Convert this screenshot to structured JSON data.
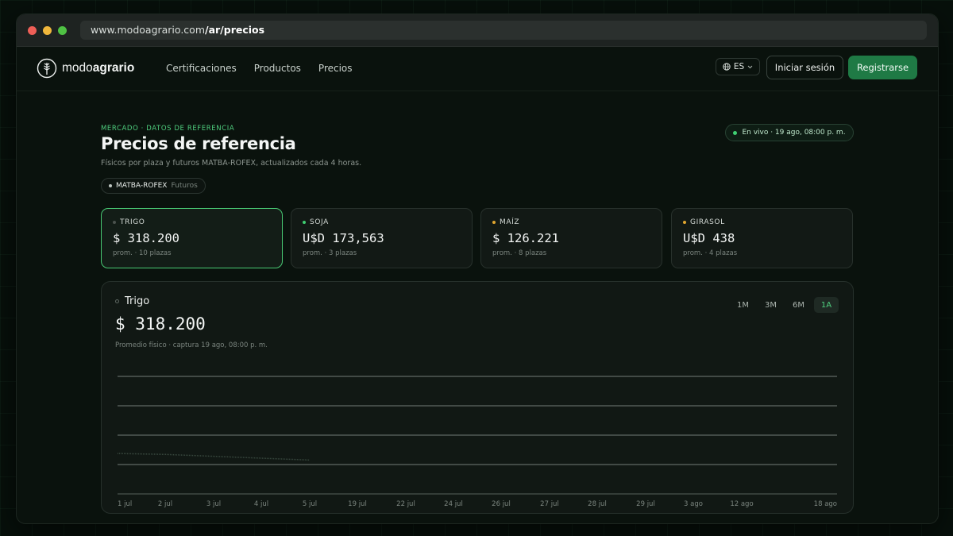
{
  "browser": {
    "url_host": "www.modoagrario.com",
    "url_path": "/ar/precios"
  },
  "nav": {
    "brand_light": "modo",
    "brand_bold": "agrario",
    "links": [
      "Certificaciones",
      "Productos",
      "Precios"
    ],
    "lang": "ES",
    "login": "Iniciar sesión",
    "register": "Registrarse"
  },
  "header": {
    "eyebrow": "MERCADO · DATOS DE REFERENCIA",
    "title": "Precios de referencia",
    "subtitle": "Físicos por plaza y futuros MATBA-ROFEX, actualizados cada 4 horas.",
    "live": "En vivo · 19 ago, 08:00 p. m.",
    "source_name": "MATBA-ROFEX",
    "source_type": "Futuros"
  },
  "cards": [
    {
      "label": "TRIGO",
      "price": "$ 318.200",
      "sub": "prom. · 10 plazas",
      "dot_color": "#4a524d",
      "active": true
    },
    {
      "label": "SOJA",
      "price": "U$D 173,563",
      "sub": "prom. · 3 plazas",
      "dot_color": "#3fcf72",
      "active": false
    },
    {
      "label": "MAÍZ",
      "price": "$ 126.221",
      "sub": "prom. · 8 plazas",
      "dot_color": "#e0a62f",
      "active": false
    },
    {
      "label": "GIRASOL",
      "price": "U$D 438",
      "sub": "prom. · 4 plazas",
      "dot_color": "#e0a62f",
      "active": false
    }
  ],
  "panel": {
    "title": "Trigo",
    "price": "$ 318.200",
    "caption": "Promedio físico · captura 19 ago, 08:00 p. m.",
    "ranges": [
      "1M",
      "3M",
      "6M",
      "1A"
    ],
    "active_range": "1A"
  },
  "chart_data": {
    "type": "line",
    "x": [
      "1 jul",
      "2 jul",
      "3 jul",
      "4 jul",
      "5 jul",
      "19 jul",
      "22 jul",
      "24 jul",
      "26 jul",
      "27 jul",
      "28 jul",
      "29 jul",
      "3 ago",
      "12 ago",
      "18 ago"
    ],
    "x_ticks": [
      "1 jul",
      "2 jul",
      "3 jul",
      "4 jul",
      "5 jul",
      "19 jul",
      "22 jul",
      "24 jul",
      "26 jul",
      "27 jul",
      "28 jul",
      "29 jul",
      "3 ago",
      "12 ago",
      "18 ago"
    ],
    "series": [
      {
        "values": [
          0.82,
          0.83,
          0.85,
          0.87,
          0.89
        ],
        "color": "#3a4a40"
      }
    ],
    "grid": true,
    "gridlines": 5,
    "xlabel": "",
    "ylabel": ""
  }
}
